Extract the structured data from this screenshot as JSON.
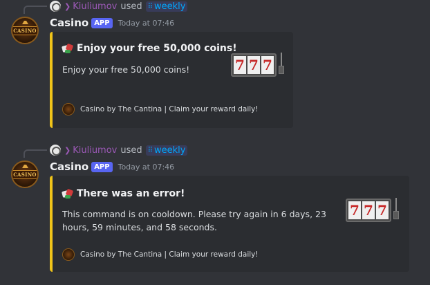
{
  "messages": [
    {
      "reply": {
        "user": "Kiuliumov",
        "used": "used",
        "command": "weekly"
      },
      "author": "Casino",
      "tag": "APP",
      "time": "Today at 07:46",
      "avatar_text": "CASINO",
      "embed": {
        "title": "Enjoy your free 50,000 coins!",
        "description": "Enjoy your free 50,000 coins!",
        "thumbnail": "777",
        "footer": "Casino by The Cantina | Claim your reward daily!",
        "accent_color": "#f0c419"
      }
    },
    {
      "reply": {
        "user": "Kiuliumov",
        "used": "used",
        "command": "weekly"
      },
      "author": "Casino",
      "tag": "APP",
      "time": "Today at 07:46",
      "avatar_text": "CASINO",
      "embed": {
        "title": "There was an error!",
        "description": "This command is on cooldown. Please try again in 6 days, 23 hours, 59 minutes, and 58 seconds.",
        "thumbnail": "777",
        "footer": "Casino by The Cantina | Claim your reward daily!",
        "accent_color": "#f0c419"
      }
    }
  ],
  "icons": {
    "reply_avatar": "globe-avatar-icon",
    "command": "slash-command-grid-icon",
    "embed_title": "dice-icon",
    "footer": "casino-logo-icon",
    "thumbnail": "slot-machine-icon"
  },
  "colors": {
    "background": "#313338",
    "embed_bg": "#2b2d31",
    "app_tag": "#5865f2",
    "username": "#9b59b6",
    "command": "#00a8fc"
  }
}
